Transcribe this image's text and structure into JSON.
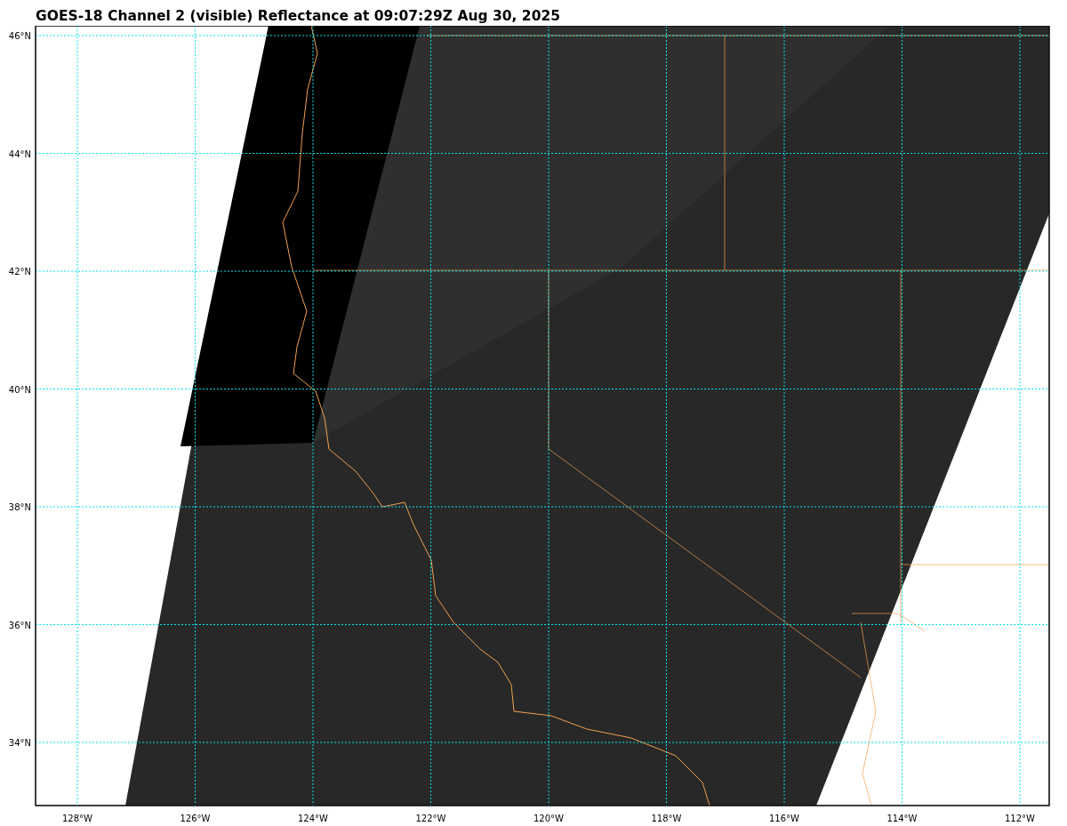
{
  "title": "GOES-18 Channel 2 (visible) Reflectance at 09:07:29Z Aug 30, 2025",
  "map": {
    "x_ticks": [
      "128°W",
      "126°W",
      "124°W",
      "122°W",
      "120°W",
      "118°W",
      "116°W",
      "114°W",
      "112°W"
    ],
    "y_ticks": [
      "46°N",
      "44°N",
      "42°N",
      "40°N",
      "38°N",
      "36°N",
      "34°N"
    ]
  }
}
